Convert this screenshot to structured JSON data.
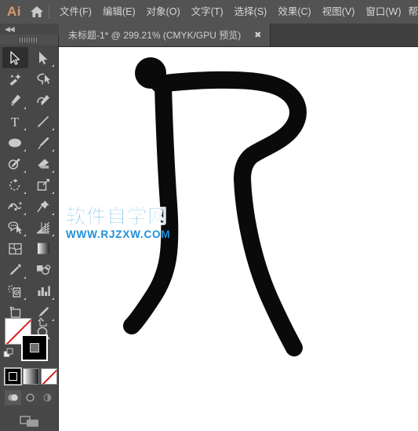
{
  "app": {
    "logo": "Ai",
    "logo_color": "#d89a6e",
    "home_icon": "home-icon"
  },
  "menubar": {
    "background": "#535353",
    "items": [
      {
        "label": "文件(F)",
        "name": "menu-file"
      },
      {
        "label": "编辑(E)",
        "name": "menu-edit"
      },
      {
        "label": "对象(O)",
        "name": "menu-object"
      },
      {
        "label": "文字(T)",
        "name": "menu-type"
      },
      {
        "label": "选择(S)",
        "name": "menu-select"
      },
      {
        "label": "效果(C)",
        "name": "menu-effect"
      },
      {
        "label": "视图(V)",
        "name": "menu-view"
      },
      {
        "label": "窗口(W)",
        "name": "menu-window"
      }
    ],
    "overflow": "帮"
  },
  "tabbar": {
    "tab_title": "未标题-1* @ 299.21% (CMYK/GPU 预览)",
    "close_label": "✖",
    "zoom_level": "299.21%",
    "color_mode": "CMYK",
    "render_mode": "GPU 预览",
    "document_name": "未标题-1*"
  },
  "toolpanel": {
    "collapse_label": "◀◀",
    "tools": [
      {
        "name": "selection-tool",
        "label": "选择工具",
        "active": true,
        "corner": false
      },
      {
        "name": "direct-selection-tool",
        "label": "直接选择工具",
        "active": false,
        "corner": true
      },
      {
        "name": "magic-wand-tool",
        "label": "魔棒工具",
        "active": false,
        "corner": false
      },
      {
        "name": "lasso-tool",
        "label": "套索工具",
        "active": false,
        "corner": false
      },
      {
        "name": "pen-tool",
        "label": "钢笔工具",
        "active": false,
        "corner": true
      },
      {
        "name": "curvature-tool",
        "label": "曲率工具",
        "active": false,
        "corner": false
      },
      {
        "name": "type-tool",
        "label": "文字工具",
        "active": false,
        "corner": true
      },
      {
        "name": "line-segment-tool",
        "label": "直线段工具",
        "active": false,
        "corner": true
      },
      {
        "name": "ellipse-tool",
        "label": "椭圆工具",
        "active": false,
        "corner": true
      },
      {
        "name": "paintbrush-tool",
        "label": "画笔工具",
        "active": false,
        "corner": true
      },
      {
        "name": "shaper-tool",
        "label": "Shaper 工具",
        "active": false,
        "corner": true
      },
      {
        "name": "eraser-tool",
        "label": "橡皮擦工具",
        "active": false,
        "corner": true
      },
      {
        "name": "rotate-tool",
        "label": "旋转工具",
        "active": false,
        "corner": true
      },
      {
        "name": "scale-tool",
        "label": "比例缩放工具",
        "active": false,
        "corner": true
      },
      {
        "name": "width-tool",
        "label": "宽度工具",
        "active": false,
        "corner": true
      },
      {
        "name": "free-transform-tool",
        "label": "自由变换工具",
        "active": false,
        "corner": true
      },
      {
        "name": "shape-builder-tool",
        "label": "形状生成器工具",
        "active": false,
        "corner": true
      },
      {
        "name": "perspective-grid-tool",
        "label": "透视网格工具",
        "active": false,
        "corner": true
      },
      {
        "name": "mesh-tool",
        "label": "网格工具",
        "active": false,
        "corner": false
      },
      {
        "name": "gradient-tool",
        "label": "渐变工具",
        "active": false,
        "corner": false
      },
      {
        "name": "eyedropper-tool",
        "label": "吸管工具",
        "active": false,
        "corner": true
      },
      {
        "name": "blend-tool",
        "label": "混合工具",
        "active": false,
        "corner": false
      },
      {
        "name": "symbol-sprayer-tool",
        "label": "符号喷枪工具",
        "active": false,
        "corner": true
      },
      {
        "name": "column-graph-tool",
        "label": "柱形图工具",
        "active": false,
        "corner": true
      },
      {
        "name": "artboard-tool",
        "label": "画板工具",
        "active": false,
        "corner": false
      },
      {
        "name": "slice-tool",
        "label": "切片工具",
        "active": false,
        "corner": true
      },
      {
        "name": "hand-tool",
        "label": "抓手工具",
        "active": false,
        "corner": true
      },
      {
        "name": "zoom-tool",
        "label": "缩放工具",
        "active": false,
        "corner": false
      }
    ],
    "color_controls": {
      "fill": {
        "value": "none",
        "color": "#ffffff",
        "name": "fill-swatch"
      },
      "stroke": {
        "value": "black",
        "color": "#000000",
        "name": "stroke-swatch"
      },
      "mode_buttons": [
        {
          "name": "color-mode-button",
          "label": "颜色",
          "selected": true
        },
        {
          "name": "gradient-mode-button",
          "label": "渐变",
          "selected": false
        },
        {
          "name": "none-mode-button",
          "label": "无",
          "selected": false
        }
      ],
      "draw_modes": [
        {
          "name": "draw-normal-button",
          "label": "正常绘图",
          "selected": true
        },
        {
          "name": "draw-behind-button",
          "label": "背面绘图",
          "selected": false
        },
        {
          "name": "draw-inside-button",
          "label": "内部绘图",
          "selected": false
        }
      ],
      "screen_mode": {
        "name": "screen-mode-button",
        "label": "更改屏幕模式"
      }
    }
  },
  "canvas": {
    "background": "#ffffff",
    "artwork_name": "chinese-character-stroke-art",
    "artwork_color": "#0a0a0a",
    "artwork_description": "手写风格汉字笔画图形"
  },
  "watermark": {
    "cn_text": "软件自学网",
    "url_text": "WWW.RJZXW.COM",
    "color": "#1a8fd6"
  }
}
